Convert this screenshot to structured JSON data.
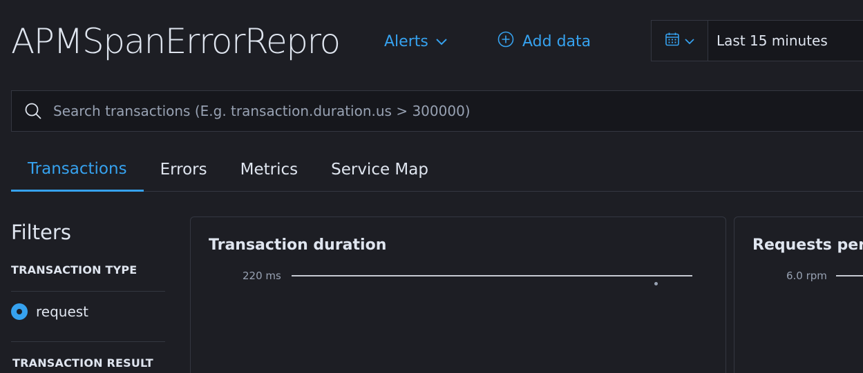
{
  "header": {
    "title": "APMSpanErrorRepro",
    "alerts_label": "Alerts",
    "add_data_label": "Add data",
    "time_range": "Last 15 minutes"
  },
  "search": {
    "placeholder": "Search transactions (E.g. transaction.duration.us > 300000)",
    "value": ""
  },
  "tabs": [
    {
      "label": "Transactions",
      "active": true
    },
    {
      "label": "Errors",
      "active": false
    },
    {
      "label": "Metrics",
      "active": false
    },
    {
      "label": "Service Map",
      "active": false
    }
  ],
  "filters": {
    "title": "Filters",
    "transaction_type": {
      "heading": "TRANSACTION TYPE",
      "options": [
        {
          "label": "request",
          "selected": true
        }
      ]
    },
    "transaction_result": {
      "heading": "TRANSACTION RESULT"
    }
  },
  "panels": [
    {
      "title": "Transaction duration",
      "y_tick": "220 ms"
    },
    {
      "title": "Requests per r",
      "y_tick": "6.0 rpm"
    }
  ],
  "colors": {
    "accent": "#36a2ef",
    "background": "#1d1e24",
    "border": "#343741",
    "text": "#dfe5ef",
    "muted": "#98a2b3"
  }
}
